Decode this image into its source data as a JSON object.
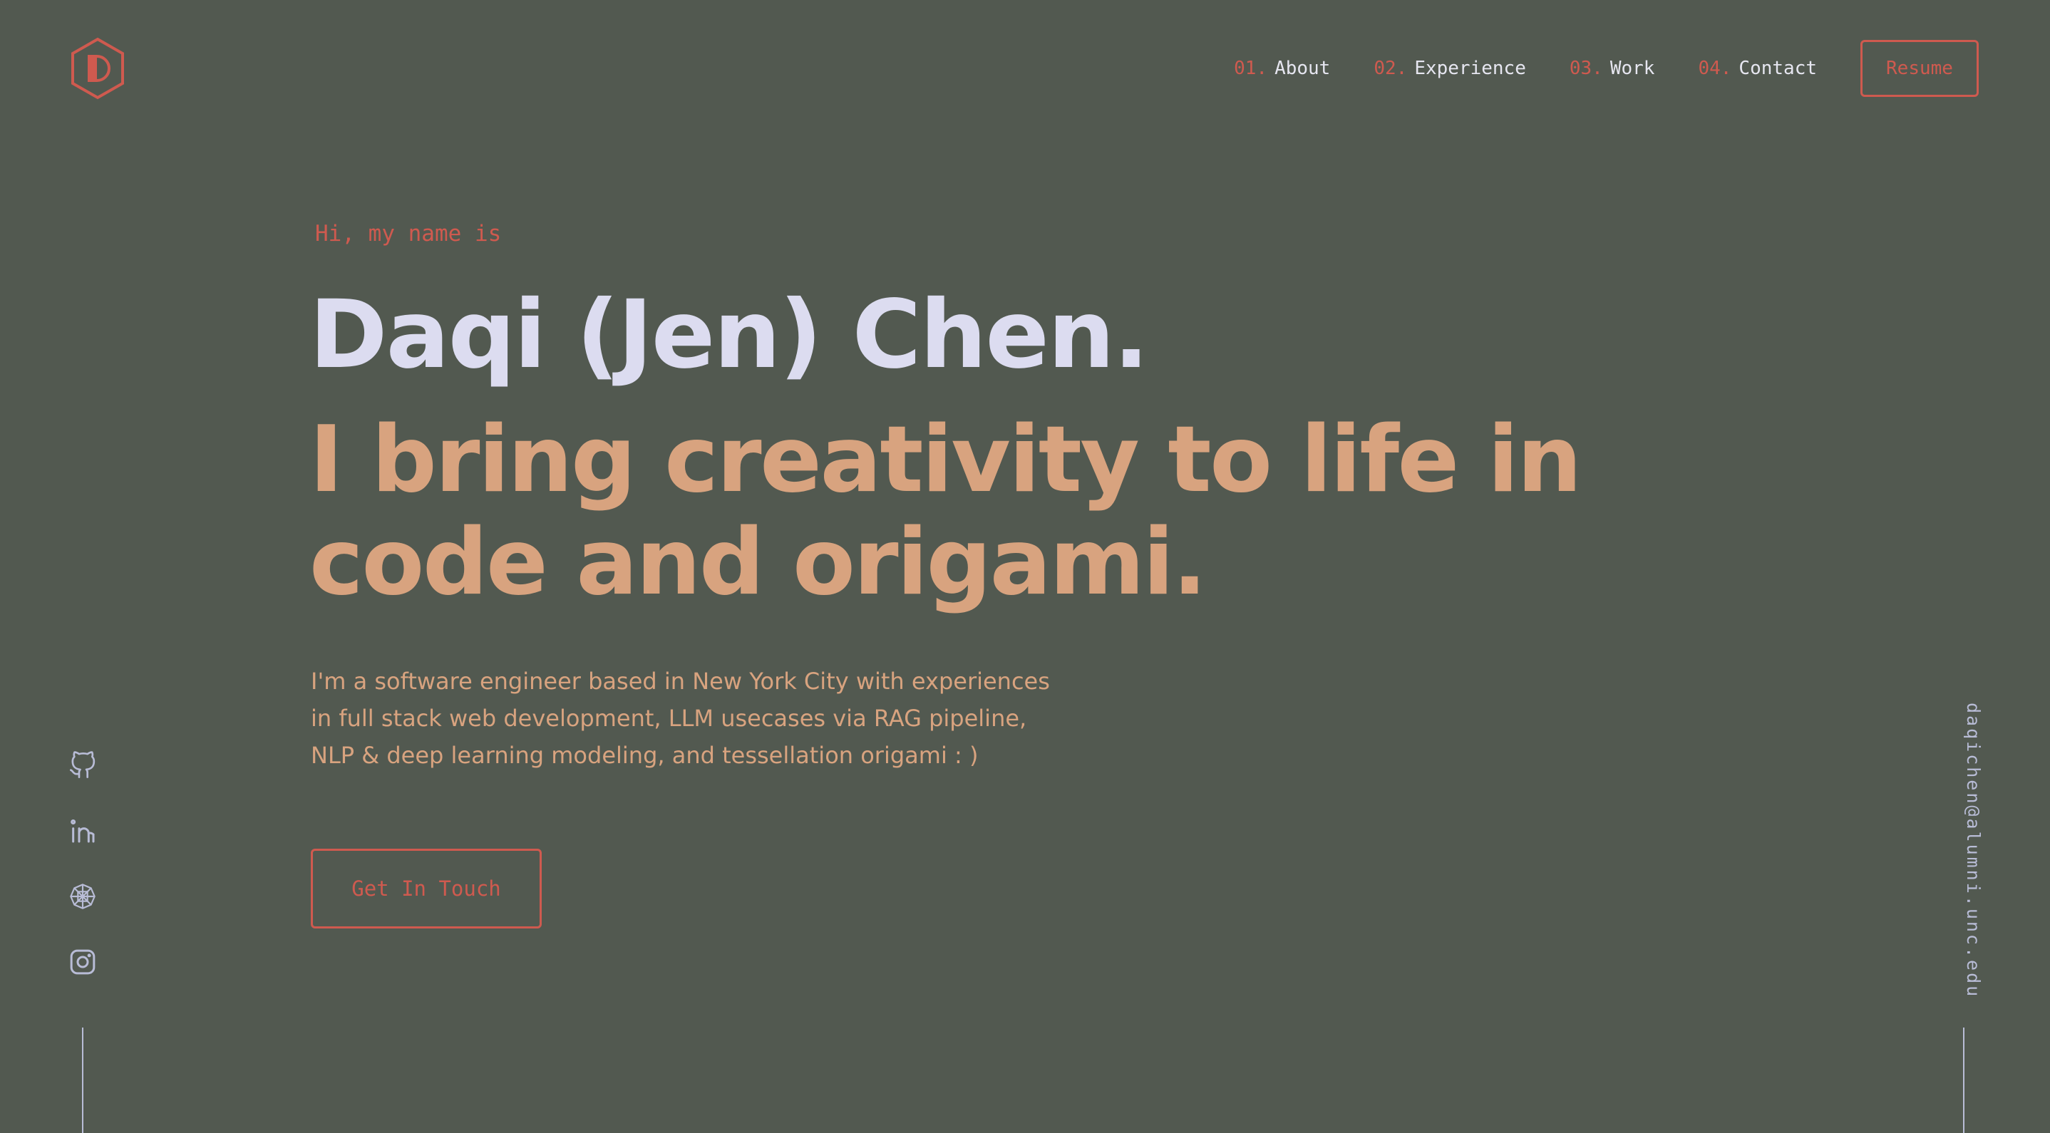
{
  "colors": {
    "background": "#525950",
    "accent": "#cf5a4f",
    "heading": "#dcdcf0",
    "tagline": "#d8a37f",
    "muted": "#b8bcd6"
  },
  "logo": {
    "icon": "hexagon-d-logo-icon"
  },
  "nav": {
    "items": [
      {
        "num": "01.",
        "label": "About"
      },
      {
        "num": "02.",
        "label": "Experience"
      },
      {
        "num": "03.",
        "label": "Work"
      },
      {
        "num": "04.",
        "label": "Contact"
      }
    ],
    "resume_label": "Resume"
  },
  "hero": {
    "greeting": "Hi, my name is",
    "name": "Daqi (Jen) Chen.",
    "tagline": "I bring creativity to life in code and origami.",
    "bio": "I'm a software engineer based in New York City with experiences in full stack web development, LLM usecases via RAG pipeline, NLP & deep learning modeling, and tessellation origami : )",
    "cta_label": "Get In Touch"
  },
  "social": [
    {
      "icon": "github-icon"
    },
    {
      "icon": "linkedin-icon"
    },
    {
      "icon": "origami-tessellation-icon"
    },
    {
      "icon": "instagram-icon"
    }
  ],
  "email": "daqichen@alumni.unc.edu"
}
